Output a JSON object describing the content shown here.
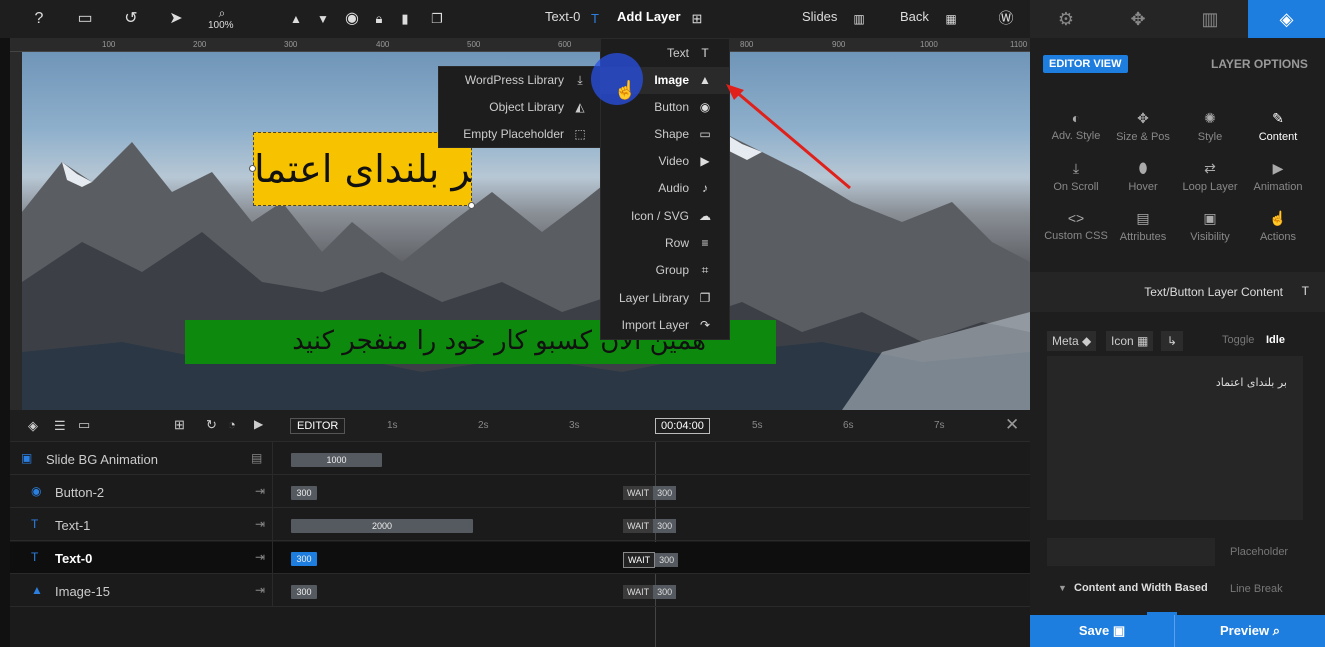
{
  "toolbar": {
    "zoom": "100%",
    "layer_name": "Text-0",
    "add_layer": "Add Layer",
    "slides": "Slides",
    "back": "Back"
  },
  "ruler": [
    "100",
    "200",
    "300",
    "400",
    "500",
    "600",
    "800",
    "900",
    "1000",
    "1100"
  ],
  "canvas": {
    "headline": "بر بلندای اعتماد",
    "subline": "همین الان کسبو کار خود را منفجر کنید"
  },
  "add_menu": {
    "items": [
      "Text",
      "Image",
      "Button",
      "Shape",
      "Video",
      "Audio",
      "Icon / SVG",
      "Row",
      "Group",
      "Layer Library",
      "Import Layer"
    ],
    "icons": [
      "T",
      "▲",
      "◉",
      "▭",
      "▶",
      "♪",
      "☁",
      "≡",
      "⌗",
      "❐",
      "↷"
    ]
  },
  "image_submenu": {
    "items": [
      "WordPress Library",
      "Object Library",
      "Empty Placeholder"
    ],
    "icons": [
      "⤓",
      "◭",
      "⬚"
    ]
  },
  "timeline": {
    "editor": "EDITOR",
    "current_time": "00:04:00",
    "ticks": [
      "1s",
      "2s",
      "3s",
      "5s",
      "6s",
      "7s"
    ],
    "rows": [
      {
        "name": "Slide BG Animation",
        "bar": "1000"
      },
      {
        "name": "Button-2",
        "bar": "300",
        "wait": "WAIT",
        "wait_val": "300"
      },
      {
        "name": "Text-1",
        "bar": "2000",
        "wait": "WAIT",
        "wait_val": "300"
      },
      {
        "name": "Text-0",
        "bar": "300",
        "wait": "WAIT",
        "wait_val": "300"
      },
      {
        "name": "Image-15",
        "bar": "300",
        "wait": "WAIT",
        "wait_val": "300"
      }
    ]
  },
  "panel": {
    "editor_view": "EDITOR VIEW",
    "layer_options": "LAYER OPTIONS",
    "options": [
      "Adv. Style",
      "Size & Pos",
      "Style",
      "Content",
      "On Scroll",
      "Hover",
      "Loop Layer",
      "Animation",
      "Custom CSS",
      "Attributes",
      "Visibility",
      "Actions"
    ],
    "section_title": "Text/Button Layer Content",
    "meta": "Meta",
    "icon": "Icon",
    "toggle": "Toggle",
    "idle": "Idle",
    "content_text": "بر بلندای اعتماد",
    "placeholder": "Placeholder",
    "content_width": "Content and Width Based",
    "line_break": "Line Break",
    "save": "Save",
    "preview": "Preview"
  },
  "colors": {
    "accent": "#1e7ee0",
    "yellow": "#f7c300",
    "green": "#0d8a0d"
  }
}
